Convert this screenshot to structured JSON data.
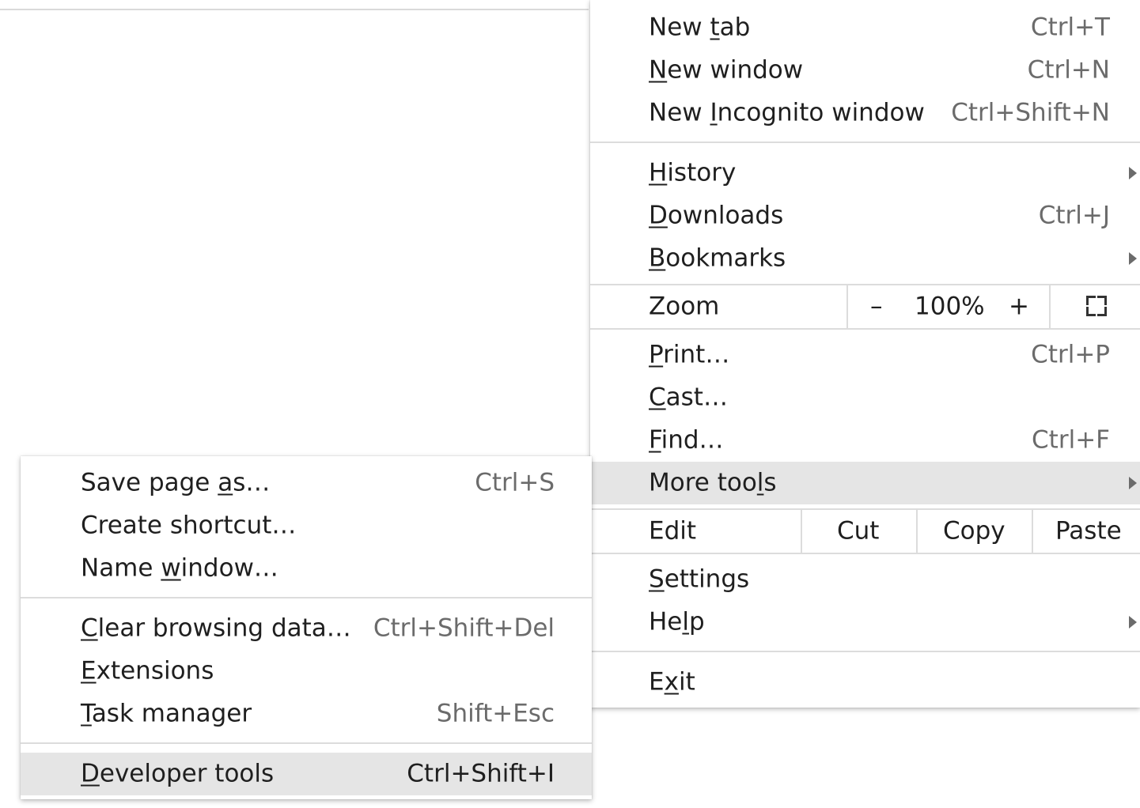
{
  "main_menu": {
    "items": [
      {
        "pre": "New ",
        "key": "t",
        "post": "ab",
        "shortcut": "Ctrl+T"
      },
      {
        "pre": "",
        "key": "N",
        "post": "ew window",
        "shortcut": "Ctrl+N"
      },
      {
        "pre": "New ",
        "key": "I",
        "post": "ncognito window",
        "shortcut": "Ctrl+Shift+N"
      },
      {
        "pre": "",
        "key": "H",
        "post": "istory",
        "shortcut": ""
      },
      {
        "pre": "",
        "key": "D",
        "post": "ownloads",
        "shortcut": "Ctrl+J"
      },
      {
        "pre": "",
        "key": "B",
        "post": "ookmarks",
        "shortcut": ""
      },
      {
        "pre": "",
        "key": "P",
        "post": "rint…",
        "shortcut": "Ctrl+P"
      },
      {
        "pre": "",
        "key": "C",
        "post": "ast…",
        "shortcut": ""
      },
      {
        "pre": "",
        "key": "F",
        "post": "ind…",
        "shortcut": "Ctrl+F"
      },
      {
        "pre": "More too",
        "key": "l",
        "post": "s",
        "shortcut": ""
      },
      {
        "pre": "",
        "key": "S",
        "post": "ettings",
        "shortcut": ""
      },
      {
        "pre": "He",
        "key": "l",
        "post": "p",
        "shortcut": ""
      },
      {
        "pre": "E",
        "key": "x",
        "post": "it",
        "shortcut": ""
      }
    ],
    "zoom": {
      "label": "Zoom",
      "minus": "–",
      "value": "100%",
      "plus": "+"
    },
    "edit": {
      "label": "Edit",
      "cut": "Cut",
      "copy": "Copy",
      "paste": "Paste"
    }
  },
  "sub_menu": {
    "items": [
      {
        "pre": "Save page ",
        "key": "a",
        "post": "s…",
        "shortcut": "Ctrl+S"
      },
      {
        "pre": "Create shortcut…",
        "key": "",
        "post": "",
        "shortcut": ""
      },
      {
        "pre": "Name ",
        "key": "w",
        "post": "indow…",
        "shortcut": ""
      },
      {
        "pre": "",
        "key": "C",
        "post": "lear browsing data…",
        "shortcut": "Ctrl+Shift+Del"
      },
      {
        "pre": "",
        "key": "E",
        "post": "xtensions",
        "shortcut": ""
      },
      {
        "pre": "",
        "key": "T",
        "post": "ask manager",
        "shortcut": "Shift+Esc"
      },
      {
        "pre": "",
        "key": "D",
        "post": "eveloper tools",
        "shortcut": "Ctrl+Shift+I"
      }
    ]
  },
  "colors": {
    "highlight": "#e5e5e5",
    "shortcut_text": "#6b6b6b",
    "separator": "#dcdcdc"
  }
}
